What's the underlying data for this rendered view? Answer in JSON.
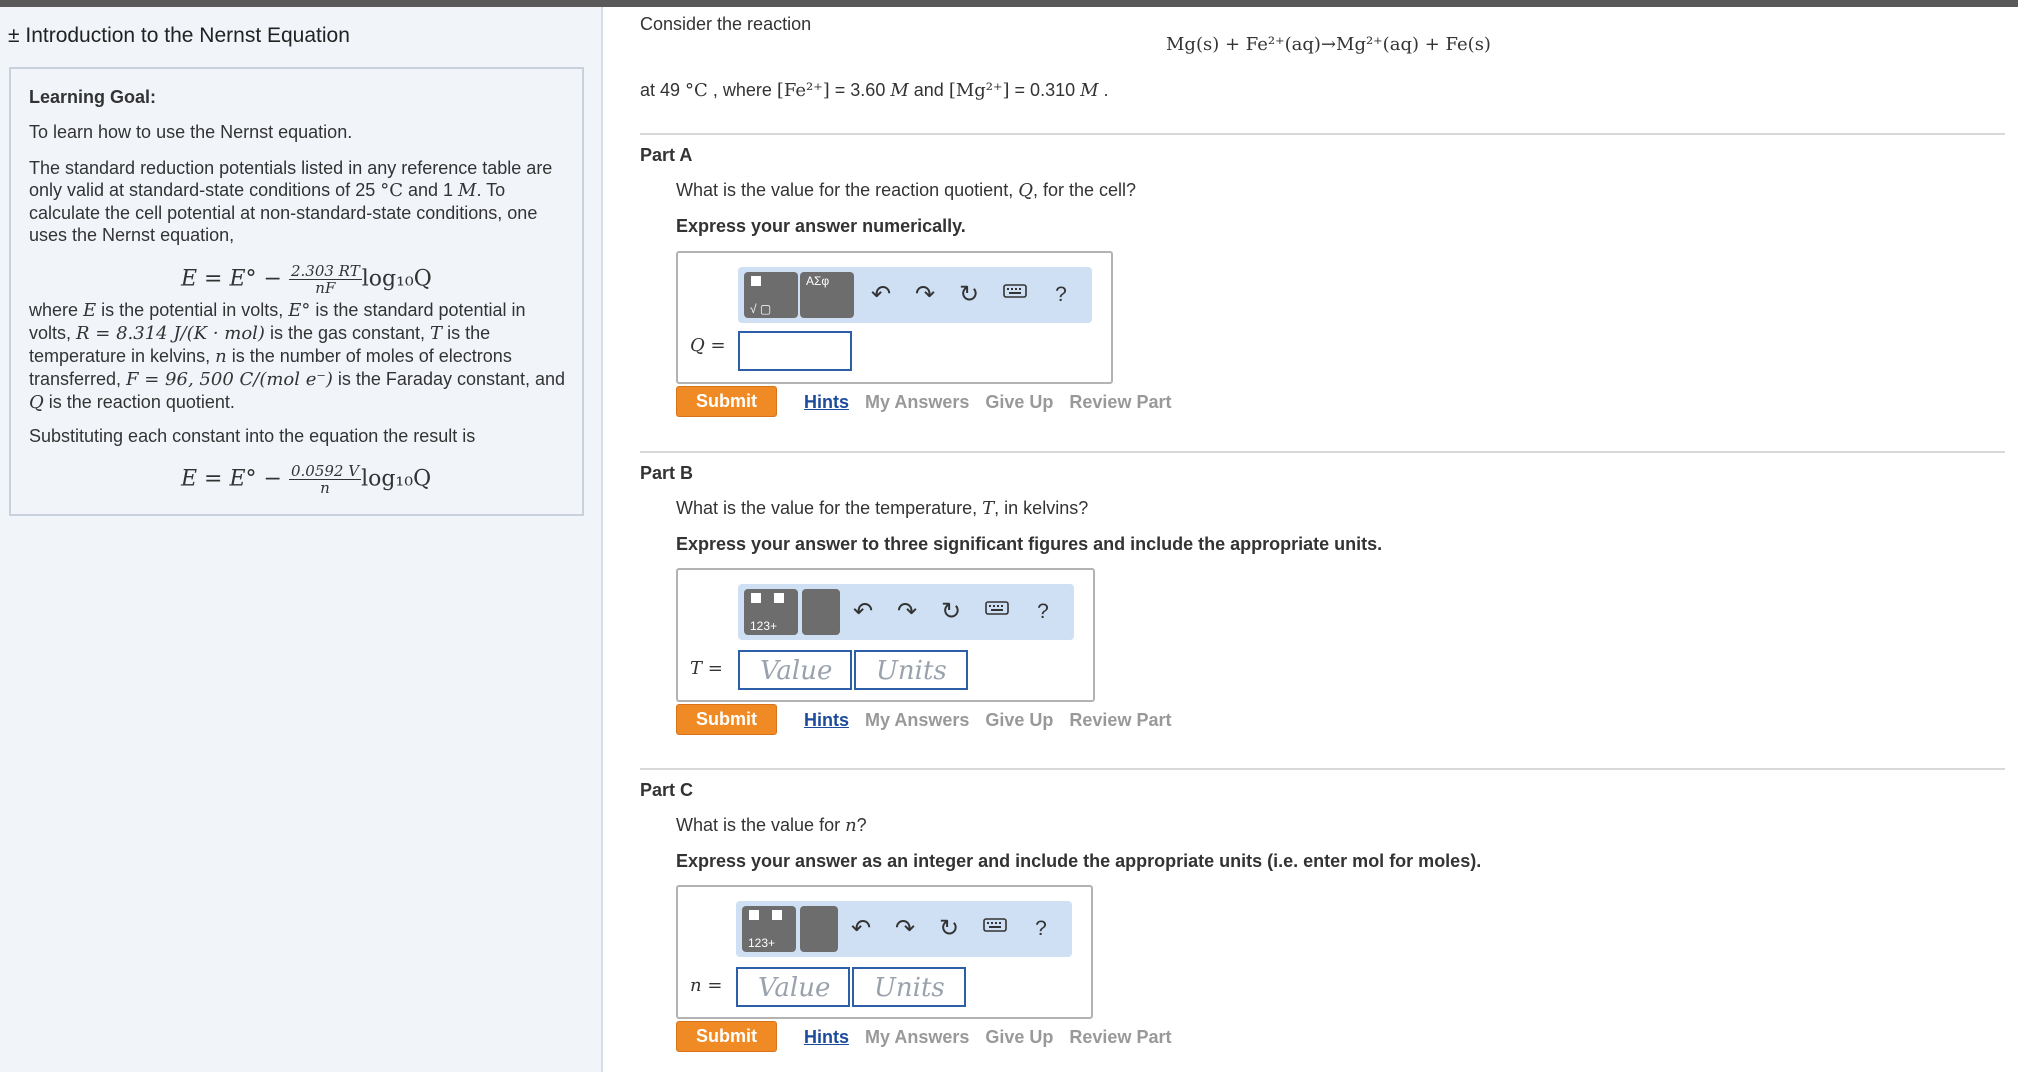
{
  "sidebar": {
    "title": "± Introduction to the Nernst Equation",
    "goal_heading": "Learning Goal:",
    "goal_text": "To learn how to use the Nernst equation.",
    "para1_a": "The standard reduction potentials listed in any reference table are only valid at standard-state conditions of 25 ",
    "para1_deg": "°C",
    "para1_b": " and 1 ",
    "para1_M": "M",
    "para1_c": ". To calculate the cell potential at non-standard-state conditions, one uses the Nernst equation,",
    "eq1_left": "E = E° − ",
    "eq1_num": "2.303 RT",
    "eq1_den": "nF",
    "eq1_right": "log₁₀Q",
    "para2_a": "where ",
    "para2_E": "E",
    "para2_b": " is the potential in volts, ",
    "para2_E0": "E°",
    "para2_c": " is the standard potential in volts, ",
    "para2_R": "R = 8.314 J/(K · mol)",
    "para2_d": " is the gas constant, ",
    "para2_T": "T",
    "para2_e": " is the temperature in kelvins, ",
    "para2_n": "n",
    "para2_f": " is the number of moles of electrons transferred, ",
    "para2_F": "F = 96, 500 C/(mol e⁻)",
    "para2_g": " is the Faraday constant, and ",
    "para2_Q": "Q",
    "para2_h": " is the reaction quotient.",
    "para3": "Substituting each constant into the equation the result is",
    "eq2_left": "E = E° − ",
    "eq2_num": "0.0592 V",
    "eq2_den": "n",
    "eq2_right": "log₁₀Q"
  },
  "main": {
    "intro": "Consider the reaction",
    "reaction": "Mg(s) + Fe²⁺(aq)→Mg²⁺(aq) + Fe(s)",
    "cond_a": "at 49 ",
    "cond_deg": "°C",
    "cond_b": " , where ",
    "cond_fe": "[Fe²⁺]",
    "cond_c": " = 3.60 ",
    "cond_M1": "M",
    "cond_d": " and ",
    "cond_mg": "[Mg²⁺]",
    "cond_e": " = 0.310 ",
    "cond_M2": "M",
    "cond_f": " ."
  },
  "parts": [
    {
      "title": "Part A",
      "question_a": "What is the value for the reaction quotient, ",
      "question_var": "Q",
      "question_b": ", for the cell?",
      "instruction": "Express your answer numerically.",
      "var_label": "Q =",
      "value": "",
      "template_label": "ΑΣφ"
    },
    {
      "title": "Part B",
      "question_a": "What is the value for the temperature, ",
      "question_var": "T",
      "question_b": ", in kelvins?",
      "instruction": "Express your answer to three significant figures and include the appropriate units.",
      "var_label": "T =",
      "value_placeholder": "Value",
      "units_placeholder": "Units"
    },
    {
      "title": "Part C",
      "question_a": "What is the value for ",
      "question_var": "n",
      "question_b": "?",
      "instruction": "Express your answer as an integer and include the appropriate units (i.e. enter mol for moles).",
      "var_label": "n =",
      "value_placeholder": "Value",
      "units_placeholder": "Units"
    }
  ],
  "actions": {
    "submit": "Submit",
    "hints": "Hints",
    "my_answers": "My Answers",
    "give_up": "Give Up",
    "review_part": "Review Part",
    "help": "?"
  },
  "icons": [
    "undo-icon",
    "redo-icon",
    "reset-icon",
    "keyboard-icon",
    "help-icon"
  ],
  "colors": {
    "accent": "#f08a24",
    "link": "#1d4b9b",
    "toolbar": "#cfe0f5",
    "input_border": "#2d5fa8"
  }
}
